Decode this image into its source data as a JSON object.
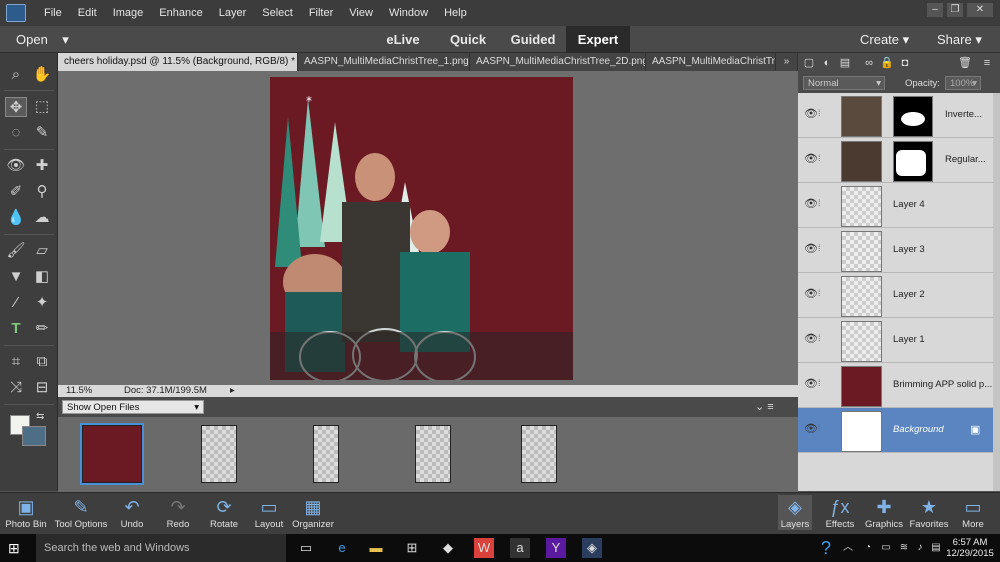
{
  "menubar": {
    "items": [
      "File",
      "Edit",
      "Image",
      "Enhance",
      "Layer",
      "Select",
      "Filter",
      "View",
      "Window",
      "Help"
    ]
  },
  "modebar": {
    "open_label": "Open",
    "modes": [
      "eLive",
      "Quick",
      "Guided",
      "Expert"
    ],
    "create_label": "Create",
    "share_label": "Share"
  },
  "tabs": [
    "cheers holiday.psd @ 11.5% (Background, RGB/8) *",
    "AASPN_MultiMediaChristTree_1.png",
    "AASPN_MultiMediaChristTree_2D.png",
    "AASPN_MultiMediaChristTree"
  ],
  "tabs_more": "»",
  "status": {
    "zoom": "11.5%",
    "doc": "Doc: 37.1M/199.5M"
  },
  "bin": {
    "show_label": "Show Open Files"
  },
  "layers_panel": {
    "blend_mode": "Normal",
    "opacity_label": "Opacity:",
    "opacity_value": "100%",
    "layers": [
      {
        "name": "Inverte..."
      },
      {
        "name": "Regular..."
      },
      {
        "name": "Layer 4"
      },
      {
        "name": "Layer 3"
      },
      {
        "name": "Layer 2"
      },
      {
        "name": "Layer 1"
      },
      {
        "name": "Brimming APP solid p..."
      },
      {
        "name": "Background"
      }
    ]
  },
  "bottom_left": [
    "Photo Bin",
    "Tool Options",
    "Undo",
    "Redo",
    "Rotate",
    "Layout",
    "Organizer"
  ],
  "bottom_right": [
    "Layers",
    "Effects",
    "Graphics",
    "Favorites",
    "More"
  ],
  "taskbar": {
    "search_placeholder": "Search the web and Windows",
    "time": "6:57 AM",
    "date": "12/29/2015"
  },
  "colors": {
    "image_bg": "#6b1a24",
    "accent": "#5b85c0"
  }
}
